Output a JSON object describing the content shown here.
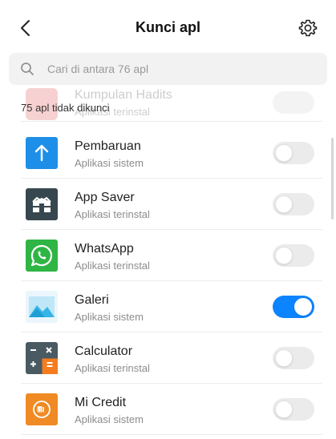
{
  "header": {
    "title": "Kunci apl",
    "back_icon": "back-arrow-icon",
    "settings_icon": "gear-icon"
  },
  "search": {
    "placeholder": "Cari di antara 76 apl",
    "value": ""
  },
  "ghost_row": {
    "name": "Kumpulan Hadits",
    "subtitle": "Aplikasi terinstal"
  },
  "status": {
    "text": "75 apl tidak dikunci"
  },
  "colors": {
    "accent": "#0d84ff",
    "toggle_off": "#ebebeb"
  },
  "apps": [
    {
      "name": "Pembaruan",
      "subtitle": "Aplikasi sistem",
      "icon": "update-arrow-icon",
      "locked": false
    },
    {
      "name": "App Saver",
      "subtitle": "Aplikasi terinstal",
      "icon": "app-saver-icon",
      "locked": false
    },
    {
      "name": "WhatsApp",
      "subtitle": "Aplikasi terinstal",
      "icon": "whatsapp-icon",
      "locked": false
    },
    {
      "name": "Galeri",
      "subtitle": "Aplikasi sistem",
      "icon": "gallery-icon",
      "locked": true
    },
    {
      "name": "Calculator",
      "subtitle": "Aplikasi terinstal",
      "icon": "calculator-icon",
      "locked": false
    },
    {
      "name": "Mi Credit",
      "subtitle": "Aplikasi sistem",
      "icon": "mi-credit-icon",
      "locked": false
    }
  ]
}
